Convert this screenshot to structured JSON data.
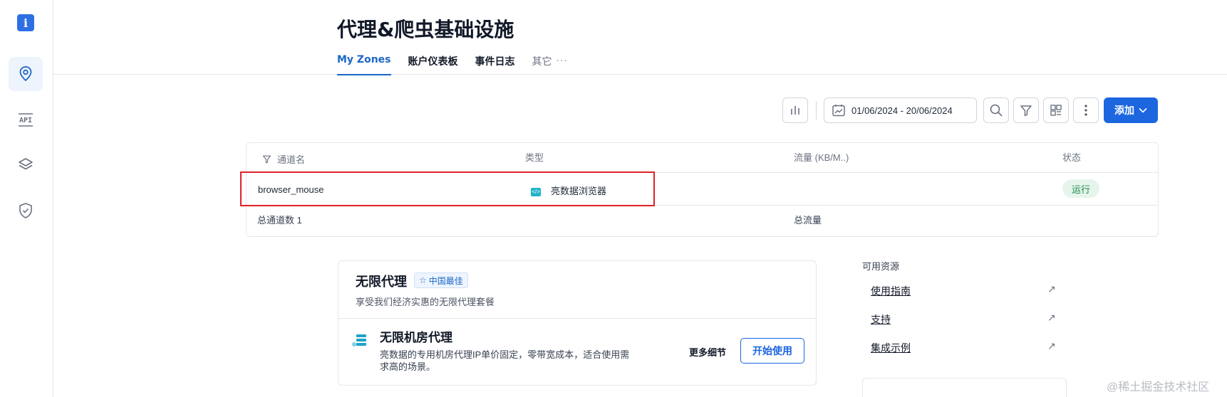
{
  "rail": {
    "logo_glyph": "i",
    "items": [
      {
        "icon": "location-pin-icon",
        "active": true
      },
      {
        "icon": "api-icon",
        "label": "API"
      },
      {
        "icon": "layers-icon"
      },
      {
        "icon": "shield-check-icon"
      }
    ]
  },
  "header": {
    "title": "代理&爬虫基础设施",
    "tabs": [
      {
        "label": "My Zones",
        "active": true
      },
      {
        "label": "账户仪表板"
      },
      {
        "label": "事件日志"
      },
      {
        "label": "其它"
      }
    ]
  },
  "toolbar": {
    "date_range": "01/06/2024 - 20/06/2024",
    "add_label": "添加"
  },
  "table": {
    "columns": [
      "通道名",
      "类型",
      "流量 (KB/M..)",
      "状态"
    ],
    "rows": [
      {
        "name": "browser_mouse",
        "type": "亮数据浏览器",
        "traffic": "",
        "status": "运行"
      }
    ],
    "footer": {
      "total_zones": "总通道数 1",
      "total_traffic": "总流量"
    }
  },
  "promo": {
    "title": "无限代理",
    "badge": "中国最佳",
    "subtitle": "享受我们经济实惠的无限代理套餐",
    "product_title": "无限机房代理",
    "product_desc": "亮数据的专用机房代理IP单价固定，零带宽成本，适合使用需求高的场景。",
    "more_label": "更多细节",
    "start_label": "开始使用"
  },
  "resources": {
    "title": "可用资源",
    "items": [
      "使用指南",
      "支持",
      "集成示例"
    ]
  },
  "watermark": "@稀土掘金技术社区",
  "colors": {
    "accent": "#1c66e0",
    "status_green": "#1c8a4a",
    "highlight": "#e0202a"
  }
}
